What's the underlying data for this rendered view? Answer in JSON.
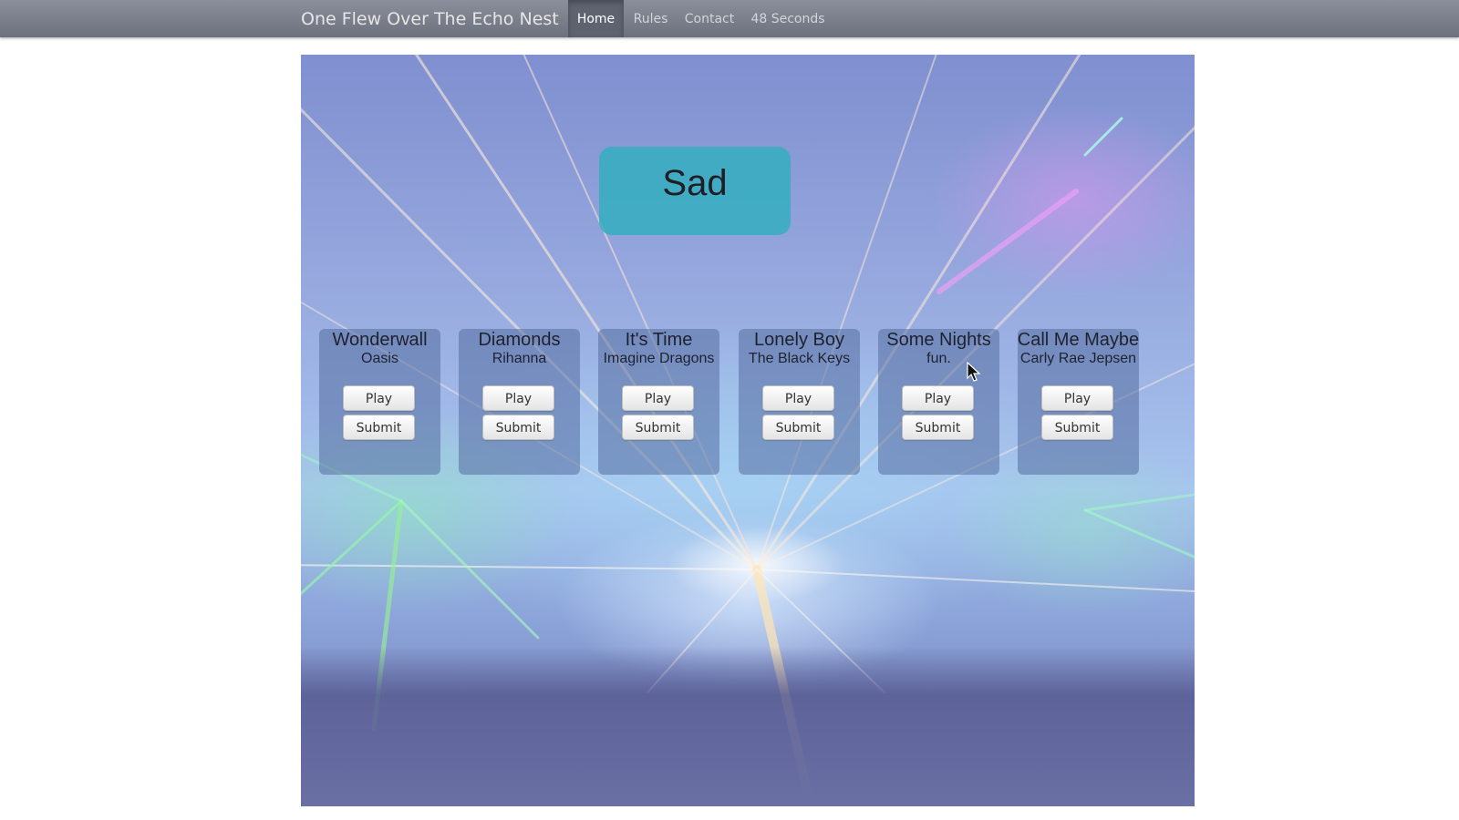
{
  "navbar": {
    "brand": "One Flew Over The Echo Nest",
    "items": [
      {
        "label": "Home",
        "active": true
      },
      {
        "label": "Rules",
        "active": false
      },
      {
        "label": "Contact",
        "active": false
      },
      {
        "label": "48 Seconds",
        "active": false
      }
    ]
  },
  "mood": {
    "label": "Sad",
    "color": "#30afbe"
  },
  "songs": [
    {
      "title": "Wonderwall",
      "artist": "Oasis",
      "play_label": "Play",
      "submit_label": "Submit"
    },
    {
      "title": "Diamonds",
      "artist": "Rihanna",
      "play_label": "Play",
      "submit_label": "Submit"
    },
    {
      "title": "It's Time",
      "artist": "Imagine Dragons",
      "play_label": "Play",
      "submit_label": "Submit"
    },
    {
      "title": "Lonely Boy",
      "artist": "The Black Keys",
      "play_label": "Play",
      "submit_label": "Submit"
    },
    {
      "title": "Some Nights",
      "artist": "fun.",
      "play_label": "Play",
      "submit_label": "Submit"
    },
    {
      "title": "Call Me Maybe",
      "artist": "Carly Rae Jepsen",
      "play_label": "Play",
      "submit_label": "Submit"
    }
  ],
  "background": {
    "description_icon": "concert-lasers-image"
  }
}
